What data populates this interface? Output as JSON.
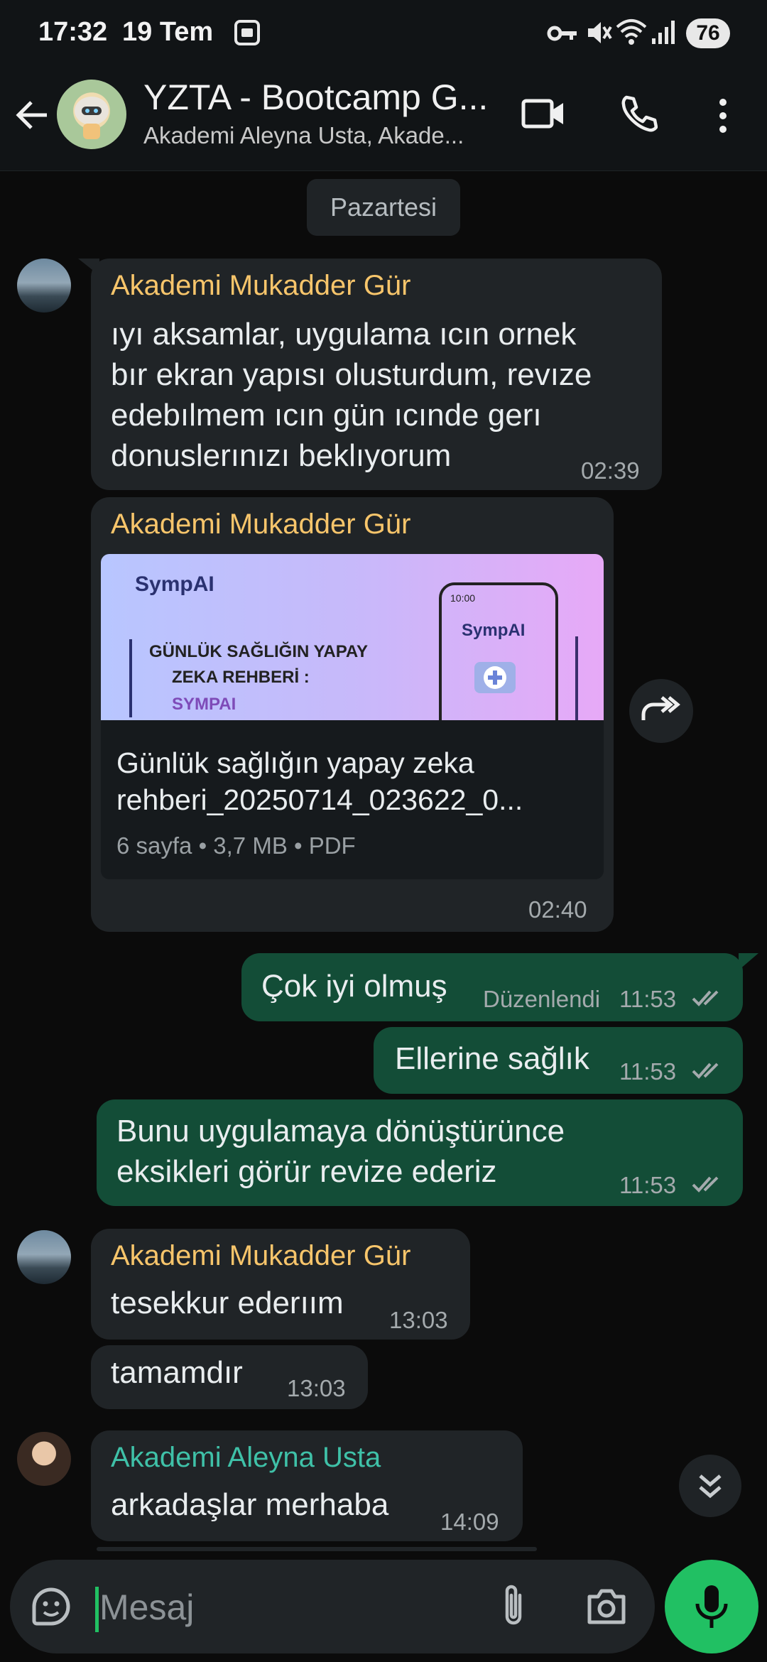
{
  "status_bar": {
    "time": "17:32",
    "date": "19 Tem",
    "battery": "76"
  },
  "header": {
    "title": "YZTA - Bootcamp G...",
    "subtitle": "Akademi Aleyna Usta, Akade...",
    "icons": [
      "back-arrow-icon",
      "video-call-icon",
      "phone-icon",
      "more-vert-icon"
    ]
  },
  "day_separator": "Pazartesi",
  "messages": [
    {
      "sender": "Akademi Mukadder Gür",
      "lines": [
        "ıyı aksamlar, uygulama ıcın ornek",
        "bır ekran yapısı olusturdum, revıze",
        "edebılmem ıcın gün ıcınde gerı",
        "donuslerınızı beklıyorum"
      ],
      "time": "02:39"
    },
    {
      "sender": "Akademi Mukadder Gür",
      "attachment": {
        "preview": {
          "brand": "SympAI",
          "headline_1": "GÜNLÜK SAĞLIĞIN YAPAY",
          "headline_2": "ZEKA REHBERİ :",
          "headline_3": "SYMPAI",
          "phone_brand": "SympAI",
          "phone_time": "10:00"
        },
        "file_name_1": "Günlük sağlığın   yapay zeka",
        "file_name_2": "rehberi_20250714_023622_0...",
        "meta": "6 sayfa • 3,7 MB • PDF"
      },
      "time": "02:40"
    },
    {
      "text": "Çok iyi olmuş",
      "edited": "Düzenlendi",
      "time": "11:53"
    },
    {
      "text": "Ellerine sağlık",
      "time": "11:53"
    },
    {
      "lines": [
        "Bunu uygulamaya dönüştürünce",
        "eksikleri görür revize ederiz"
      ],
      "time": "11:53"
    },
    {
      "sender": "Akademi Mukadder Gür",
      "text": "tesekkur ederıım",
      "time": "13:03"
    },
    {
      "text": "tamamdır",
      "time": "13:03"
    },
    {
      "sender": "Akademi Aleyna Usta",
      "text": "arkadaşlar merhaba",
      "time": "14:09"
    }
  ],
  "colors": {
    "sender_mukadder": "#f7c56b",
    "sender_aleyna": "#3fc1a8",
    "outgoing_bubble": "#134d37",
    "incoming_bubble": "#202427",
    "read_ticks": "#a4aaad",
    "mic_button": "#21c063"
  },
  "input": {
    "placeholder": "Mesaj",
    "icons": [
      "sticker-icon",
      "attach-icon",
      "camera-icon",
      "mic-icon"
    ]
  }
}
